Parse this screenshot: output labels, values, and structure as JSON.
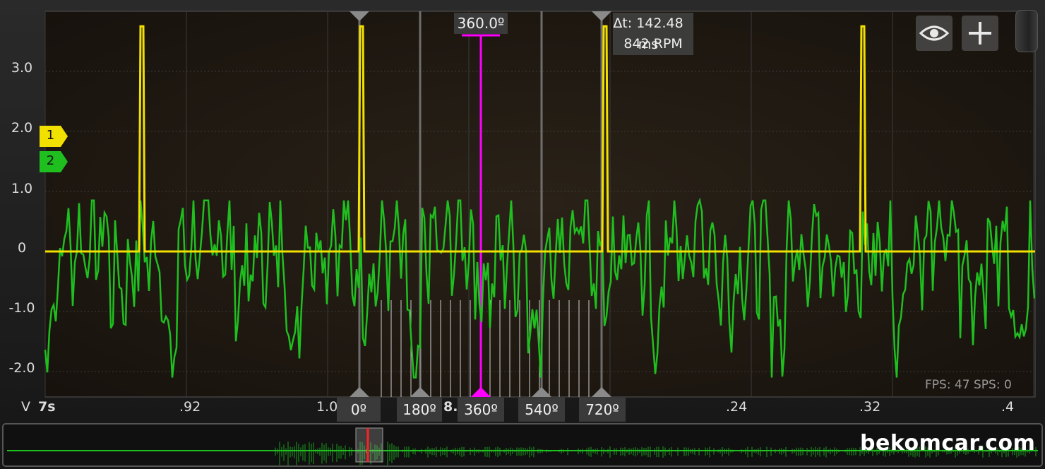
{
  "y_axis": {
    "labels": [
      {
        "text": "3.0",
        "value": 3.0
      },
      {
        "text": "2.0",
        "value": 2.0
      },
      {
        "text": "1.0",
        "value": 1.0
      },
      {
        "text": "0",
        "value": 0
      },
      {
        "text": "-1.0",
        "value": -1.0
      },
      {
        "text": "-2.0",
        "value": -2.0
      }
    ]
  },
  "x_axis": {
    "unit_label": "V",
    "labels": [
      ".7s",
      ".92",
      "1.0",
      "8.",
      ".24",
      ".32",
      ".4"
    ],
    "first_label": "7s"
  },
  "channel_tags": [
    {
      "label": "1",
      "color": "#f2e000"
    },
    {
      "label": "2",
      "color": "#1fbf1f"
    }
  ],
  "crank_markers": [
    {
      "label": "0º",
      "angle": 0,
      "color": "#8a8a8a"
    },
    {
      "label": "180º",
      "angle": 180,
      "color": "#8a8a8a"
    },
    {
      "label": "360º",
      "angle": 360,
      "color": "#ff00ff"
    },
    {
      "label": "540º",
      "angle": 540,
      "color": "#8a8a8a"
    },
    {
      "label": "720º",
      "angle": 720,
      "color": "#8a8a8a"
    }
  ],
  "top_marker_label": "360.0º",
  "delta": {
    "dt": "Δt: 142.48 ms",
    "rpm": "842 RPM"
  },
  "stats": "FPS: 47  SPS: 0",
  "watermark": "bekomcar.com",
  "toolbar": {
    "eye_icon": "eye-icon",
    "plus_icon": "plus-icon"
  },
  "chart_data": {
    "type": "line",
    "ylim": [
      -2.5,
      3.8
    ],
    "series": [
      {
        "name": "1",
        "color": "#f2e000",
        "baseline": 0.0,
        "peak": 3.75,
        "pulses_x": [
          0.95,
          1.04,
          1.14,
          1.245
        ]
      },
      {
        "name": "2",
        "color": "#1fbf1f",
        "min": -2.1,
        "max": 0.85
      }
    ],
    "x_range": [
      0.91,
      1.42
    ]
  }
}
